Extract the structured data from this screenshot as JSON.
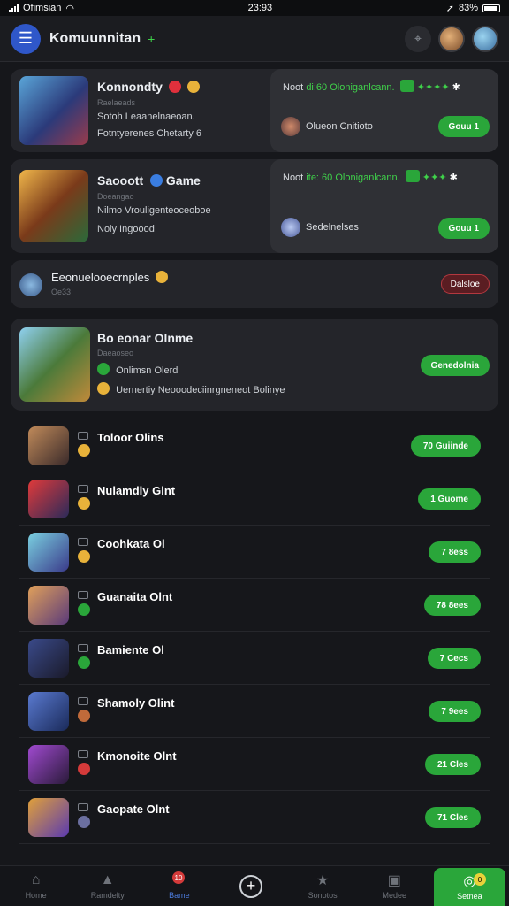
{
  "status": {
    "carrier": "Ofimsian",
    "time": "23:93",
    "battery": "83%"
  },
  "header": {
    "title": "Komuunnitan",
    "status_glyph": "+"
  },
  "cards": [
    {
      "title": "Konnondty",
      "sub": "Raelaeads",
      "line1": "Sotoh Leaanelnaeoan.",
      "line2": "Fotntyerenes Chetarty 6",
      "panel_text": "Noot",
      "panel_highlight": "di:60 Oloniganlcann.",
      "panel_user": "Olueon Cnitioto",
      "panel_button": "Gouu 1"
    },
    {
      "title": "Saooott",
      "title_tag": "Game",
      "sub": "Doeangao",
      "line1": "Nilmo Vrouligenteoceoboe",
      "line2": "Noiy Ingoood",
      "panel_text": "Noot",
      "panel_highlight": "ite: 60 Oloniganlcann.",
      "panel_user": "Sedelnelses",
      "panel_button": "Gouu 1"
    }
  ],
  "notice": {
    "title": "Eeonuelooecrnples",
    "sub": "Oe33",
    "button": "Dalsloe"
  },
  "feature": {
    "title": "Bo eonar Olnme",
    "sub": "Daeaoseo",
    "line1": "Onlimsn Olerd",
    "line2": "Uernertiy Neooodeciinrgneneot Bolinye",
    "button": "Genedolnia"
  },
  "rows": [
    {
      "name": "Toloor Olins",
      "button": "70 Guiinde",
      "dot_color": "#e8b23a"
    },
    {
      "name": "Nulamdly Glnt",
      "button": "1 Guome",
      "dot_color": "#e8b23a"
    },
    {
      "name": "Coohkata Ol",
      "button": "7 8ess",
      "dot_color": "#e8b23a"
    },
    {
      "name": "Guanaita Olnt",
      "button": "78 8ees",
      "dot_color": "#2aa63a"
    },
    {
      "name": "Bamiente Ol",
      "button": "7 Cecs",
      "dot_color": "#2aa63a"
    },
    {
      "name": "Shamoly Olint",
      "button": "7 9ees",
      "dot_color": "#c06a3a"
    },
    {
      "name": "Kmonoite Olnt",
      "button": "21 Cles",
      "dot_color": "#d43a3a"
    },
    {
      "name": "Gaopate Olnt",
      "button": "71 Cles",
      "dot_color": "#6b6fa0"
    }
  ],
  "tabs": [
    {
      "label": "Home",
      "icon": "home-icon"
    },
    {
      "label": "Ramdelty",
      "icon": "cat-icon"
    },
    {
      "label": "Bame",
      "icon": "game-icon",
      "badge": "10"
    },
    {
      "label": "",
      "icon": "plus-icon"
    },
    {
      "label": "Sonotos",
      "icon": "star-icon"
    },
    {
      "label": "Medee",
      "icon": "media-icon"
    },
    {
      "label": "Setnea",
      "icon": "settings-icon",
      "badge": "0"
    }
  ],
  "colors": {
    "accent_green": "#2aa63a",
    "accent_blue": "#2f57c9",
    "danger": "#b3383f"
  }
}
